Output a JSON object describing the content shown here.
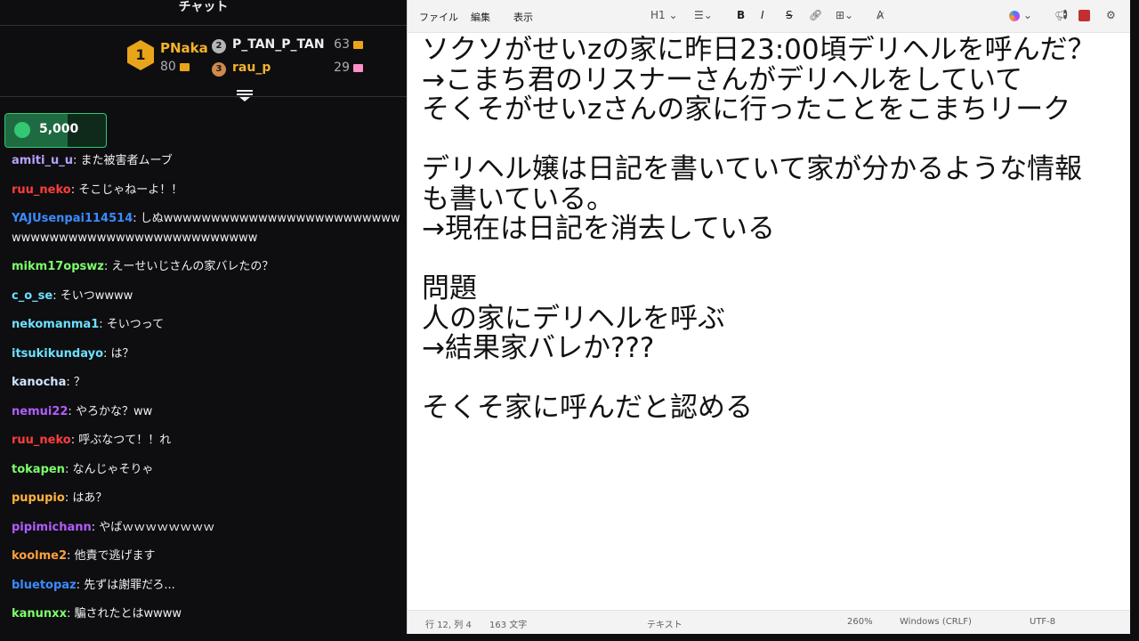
{
  "chat": {
    "title": "チャット",
    "leaderboard": {
      "first": {
        "rank": "1",
        "name": "PNaka",
        "points": "80"
      },
      "second": {
        "rank": "2",
        "name": "P_TAN_P_TAN",
        "points": "63"
      },
      "third": {
        "rank": "3",
        "name": "rau_p",
        "points": "29"
      }
    },
    "goal": {
      "value": "5,000",
      "progress_percent": 62
    },
    "messages": [
      {
        "user": "amiti_u_u",
        "color": "#b8a0ff",
        "text": "また被害者ムーブ"
      },
      {
        "user": "ruu_neko",
        "color": "#ff3d3d",
        "text": "そこじゃねーよ！！"
      },
      {
        "user": "YAJUsenpai114514",
        "color": "#3a8bff",
        "text": "しぬwwwwwwwwwwwwwwwwwwwwwwwwwwwwwwwwwwwwwwwwwwwwwwwwwww"
      },
      {
        "user": "mikm17opswz",
        "color": "#7cff6b",
        "text": "えーせいじさんの家バレたの？"
      },
      {
        "user": "c_o_se",
        "color": "#6ce0ff",
        "text": "そいつwwww"
      },
      {
        "user": "nekomanma1",
        "color": "#6ce0ff",
        "text": "そいつって"
      },
      {
        "user": "itsukikundayo",
        "color": "#6ce0ff",
        "text": "は？"
      },
      {
        "user": "kanocha",
        "color": "#cfe3ff",
        "text": "？"
      },
      {
        "user": "nemui22",
        "color": "#b35cff",
        "text": "やろかな？ww"
      },
      {
        "user": "ruu_neko",
        "color": "#ff3d3d",
        "text": "呼ぶなつて！！れ"
      },
      {
        "user": "tokapen",
        "color": "#7cff6b",
        "text": "なんじゃそりゃ"
      },
      {
        "user": "pupupio",
        "color": "#ffb23d",
        "text": "はあ？"
      },
      {
        "user": "pipimichann",
        "color": "#b35cff",
        "text": "やばｗｗｗｗｗｗｗｗ"
      },
      {
        "user": "koolme2",
        "color": "#ff9f3d",
        "text": "他責で逃げます"
      },
      {
        "user": "bluetopaz",
        "color": "#3a8bff",
        "text": "先ずは謝罪だろ..."
      },
      {
        "user": "kanunxx",
        "color": "#7cff6b",
        "text": "騙されたとはwwww"
      }
    ]
  },
  "notepad": {
    "menu": {
      "file": "ファイル",
      "edit": "編集",
      "view": "表示"
    },
    "toolbar": {
      "heading": "H1"
    },
    "content": "ソクソがせいzの家に昨日23:00頃デリヘルを呼んだ？\n→こまち君のリスナーさんがデリヘルをしていて\nそくそがせいzさんの家に行ったことをこまちリーク\n\nデリヘル嬢は日記を書いていて家が分かるような情報\nも書いている。\n→現在は日記を消去している\n\n問題\n人の家にデリヘルを呼ぶ\n→結果家バレか???\n\nそくそ家に呼んだと認める",
    "status": {
      "position": "行 12, 列 4",
      "chars": "163 文字",
      "format": "テキスト",
      "zoom": "260%",
      "eol": "Windows (CRLF)",
      "encoding": "UTF-8"
    }
  }
}
